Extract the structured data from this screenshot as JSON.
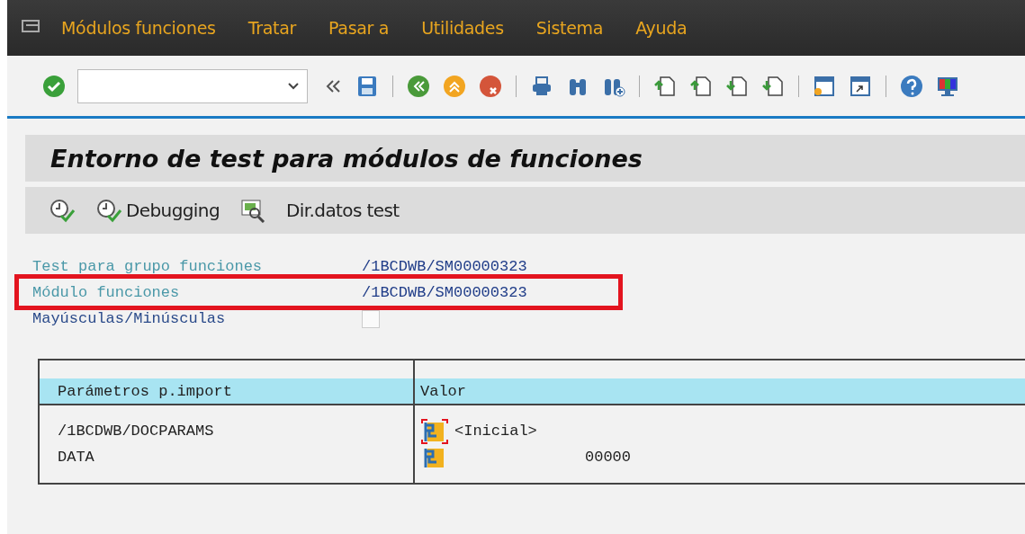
{
  "menu": [
    {
      "label": "Módulos funciones"
    },
    {
      "label": "Tratar"
    },
    {
      "label": "Pasar a"
    },
    {
      "label": "Utilidades"
    },
    {
      "label": "Sistema"
    },
    {
      "label": "Ayuda"
    }
  ],
  "title": "Entorno de test para módulos de funciones",
  "app_toolbar": [
    {
      "kind": "execute"
    },
    {
      "kind": "debug",
      "label": "Debugging"
    },
    {
      "kind": "directory",
      "label": "Dir.datos test"
    }
  ],
  "fields": [
    {
      "label": "Test para grupo funciones",
      "value": "/1BCDWB/SM00000323",
      "highlighted": false
    },
    {
      "label": "Módulo funciones",
      "value": "/1BCDWB/SM00000323",
      "highlighted": true
    },
    {
      "label": "Mayúsculas/Minúsculas",
      "kind": "checkbox",
      "checked": false,
      "highlighted": false
    }
  ],
  "table": {
    "columns": [
      "Parámetros p.import",
      "Valor"
    ],
    "rows": [
      {
        "name": "/1BCDWB/DOCPARAMS",
        "value": "<Inicial>",
        "kind": "text",
        "focused": true
      },
      {
        "name": "DATA",
        "value": "00000",
        "kind": "number",
        "focused": false
      }
    ]
  }
}
